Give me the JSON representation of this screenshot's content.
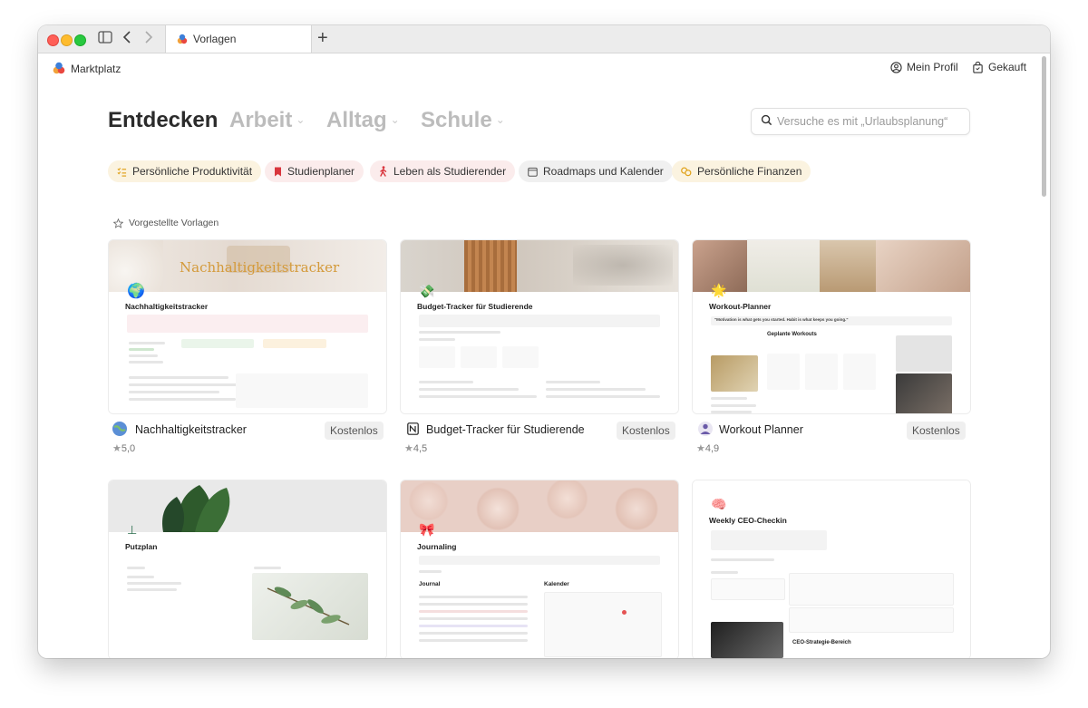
{
  "browser": {
    "tab_title": "Vorlagen",
    "new_tab": "+"
  },
  "header": {
    "brand": "Marktplatz",
    "profile_label": "Mein Profil",
    "bought_label": "Gekauft"
  },
  "categories": [
    {
      "label": "Entdecken",
      "active": true
    },
    {
      "label": "Arbeit",
      "active": false
    },
    {
      "label": "Alltag",
      "active": false
    },
    {
      "label": "Schule",
      "active": false
    }
  ],
  "search": {
    "placeholder": "Versuche es mit „Urlaubsplanung“"
  },
  "chips": [
    {
      "label": "Persönliche Produktivität",
      "icon": "checklist-icon",
      "color": "#e0a21a",
      "bg": "#fbf3e0"
    },
    {
      "label": "Studienplaner",
      "icon": "bookmark-icon",
      "color": "#d9363e",
      "bg": "#fbecec"
    },
    {
      "label": "Leben als Studierender",
      "icon": "person-walking-icon",
      "color": "#d9363e",
      "bg": "#fbecec"
    },
    {
      "label": "Roadmaps und Kalender",
      "icon": "calendar-icon",
      "color": "#555555",
      "bg": "#f0f0f0"
    },
    {
      "label": "Persönliche Finanzen",
      "icon": "coins-icon",
      "color": "#e0a21a",
      "bg": "#fbf3e0"
    }
  ],
  "featured_label": "Vorgestellte Vorlagen",
  "cards": [
    {
      "cover_text": "Nachhaltigkeitstracker",
      "page_title": "Nachhaltigkeitstracker",
      "name": "Nachhaltigkeitstracker",
      "price": "Kostenlos",
      "rating": "5,0",
      "icon": "globe-icon"
    },
    {
      "page_title": "Budget-Tracker für Studierende",
      "name": "Budget-Tracker für Studierende",
      "price": "Kostenlos",
      "rating": "4,5",
      "icon": "notion-icon"
    },
    {
      "page_title": "Workout-Planner",
      "page_quote": "\"Motivation is what gets you started. Habit is what keeps you going.\"",
      "page_subtitle": "Geplante Workouts",
      "name": "Workout Planner",
      "price": "Kostenlos",
      "rating": "4,9",
      "icon": "avatar-icon"
    },
    {
      "page_title": "Putzplan",
      "icon": "broom-icon"
    },
    {
      "page_title": "Journaling",
      "section1": "Journal",
      "section2": "Kalender",
      "icon": "bow-icon"
    },
    {
      "page_title": "Weekly CEO-Checkin",
      "section1": "CEO-Strategie-Bereich",
      "icon": "brain-icon"
    }
  ],
  "colors": {
    "accent_red": "#ff5f57",
    "accent_yellow": "#febc2e",
    "accent_green": "#28c840"
  }
}
